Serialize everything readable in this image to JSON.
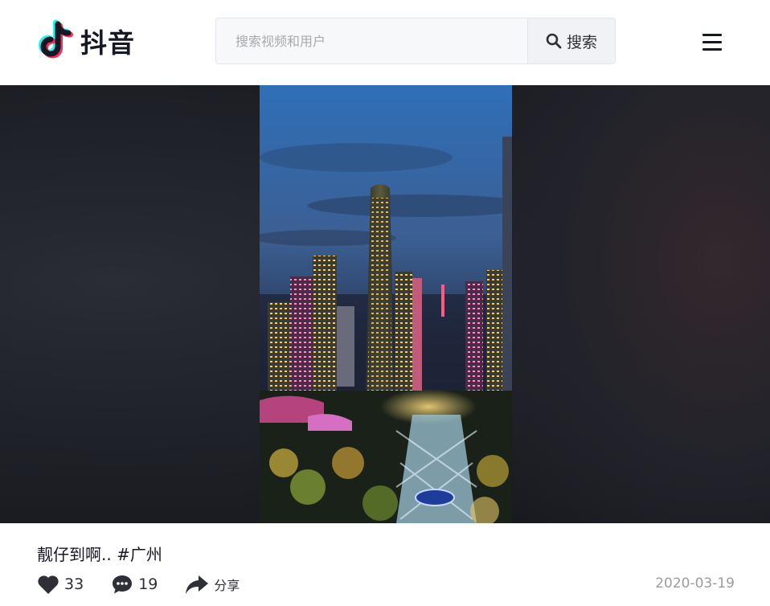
{
  "header": {
    "brand_name": "抖音",
    "search": {
      "placeholder": "搜索视频和用户",
      "button_label": "搜索"
    }
  },
  "post": {
    "caption": "靓仔到啊.. #广州",
    "likes": "33",
    "comments": "19",
    "share_label": "分享",
    "date": "2020-03-19"
  },
  "icons": {
    "logo": "douyin-note-icon",
    "search": "search-icon",
    "menu": "hamburger-menu-icon",
    "like": "heart-icon",
    "comment": "comment-bubble-icon",
    "share": "share-arrow-icon"
  },
  "colors": {
    "brand_cyan": "#25f4ee",
    "brand_red": "#fe2c55",
    "text": "#161823",
    "muted": "#9b9ca2"
  }
}
